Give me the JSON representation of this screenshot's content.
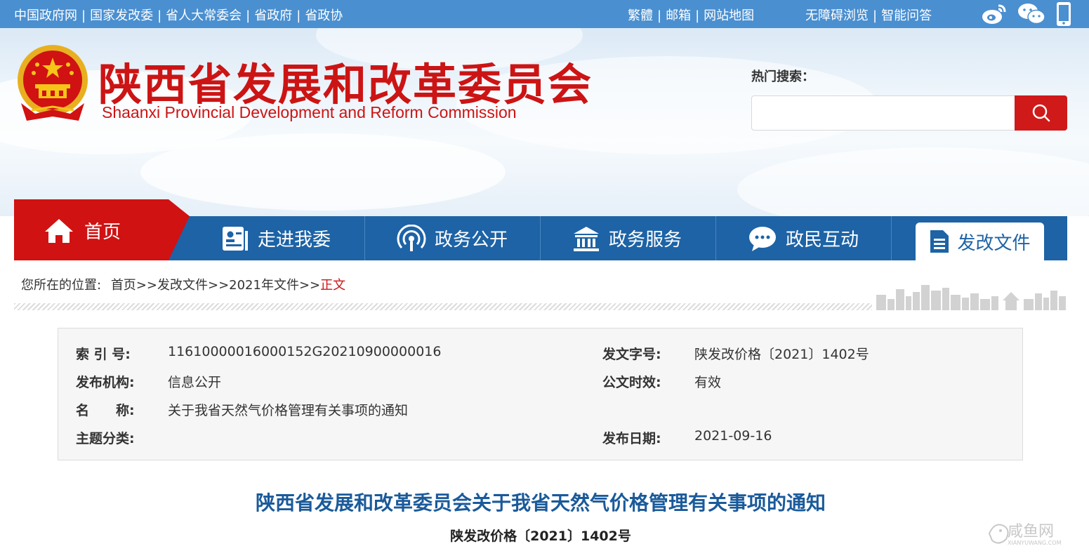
{
  "topbar": {
    "links_left": [
      "中国政府网",
      "国家发改委",
      "省人大常委会",
      "省政府",
      "省政协"
    ],
    "links_right": [
      "繁體",
      "邮箱",
      "网站地图"
    ],
    "links_right2": [
      "无障碍浏览",
      "智能问答"
    ],
    "icons": [
      "weibo-icon",
      "wechat-icon",
      "mobile-icon"
    ]
  },
  "header": {
    "title": "陕西省发展和改革委员会",
    "subtitle": "Shaanxi Provincial Development and Reform Commission",
    "hot_search_label": "热门搜索：",
    "search_placeholder": ""
  },
  "nav": {
    "home": "首页",
    "items": [
      "走进我委",
      "政务公开",
      "政务服务",
      "政民互动"
    ],
    "active": "发改文件"
  },
  "breadcrumb": {
    "prefix": "您所在的位置:",
    "items": [
      "首页",
      "发改文件",
      "2021年文件"
    ],
    "separator": ">>",
    "current": "正文"
  },
  "info": {
    "index_label": "索 引 号:",
    "index_value": "11610000016000152G20210900000016",
    "doc_no_label": "发文字号:",
    "doc_no_value": "陕发改价格〔2021〕1402号",
    "org_label": "发布机构:",
    "org_value": "信息公开",
    "validity_label": "公文时效:",
    "validity_value": "有效",
    "name_label": "名　　称:",
    "name_value": "关于我省天然气价格管理有关事项的通知",
    "topic_label": "主题分类:",
    "topic_value": "",
    "date_label": "发布日期:",
    "date_value": "2021-09-16"
  },
  "document": {
    "title": "陕西省发展和改革委员会关于我省天然气价格管理有关事项的通知",
    "number": "陕发改价格〔2021〕1402号"
  },
  "watermark": {
    "text": "咸鱼网",
    "subtext": "XIANYUWANG.COM"
  },
  "colors": {
    "topbar": "#4a8fd0",
    "brand_red": "#cc1414",
    "nav_blue": "#1d63a6",
    "title_blue": "#1a5a9a"
  }
}
